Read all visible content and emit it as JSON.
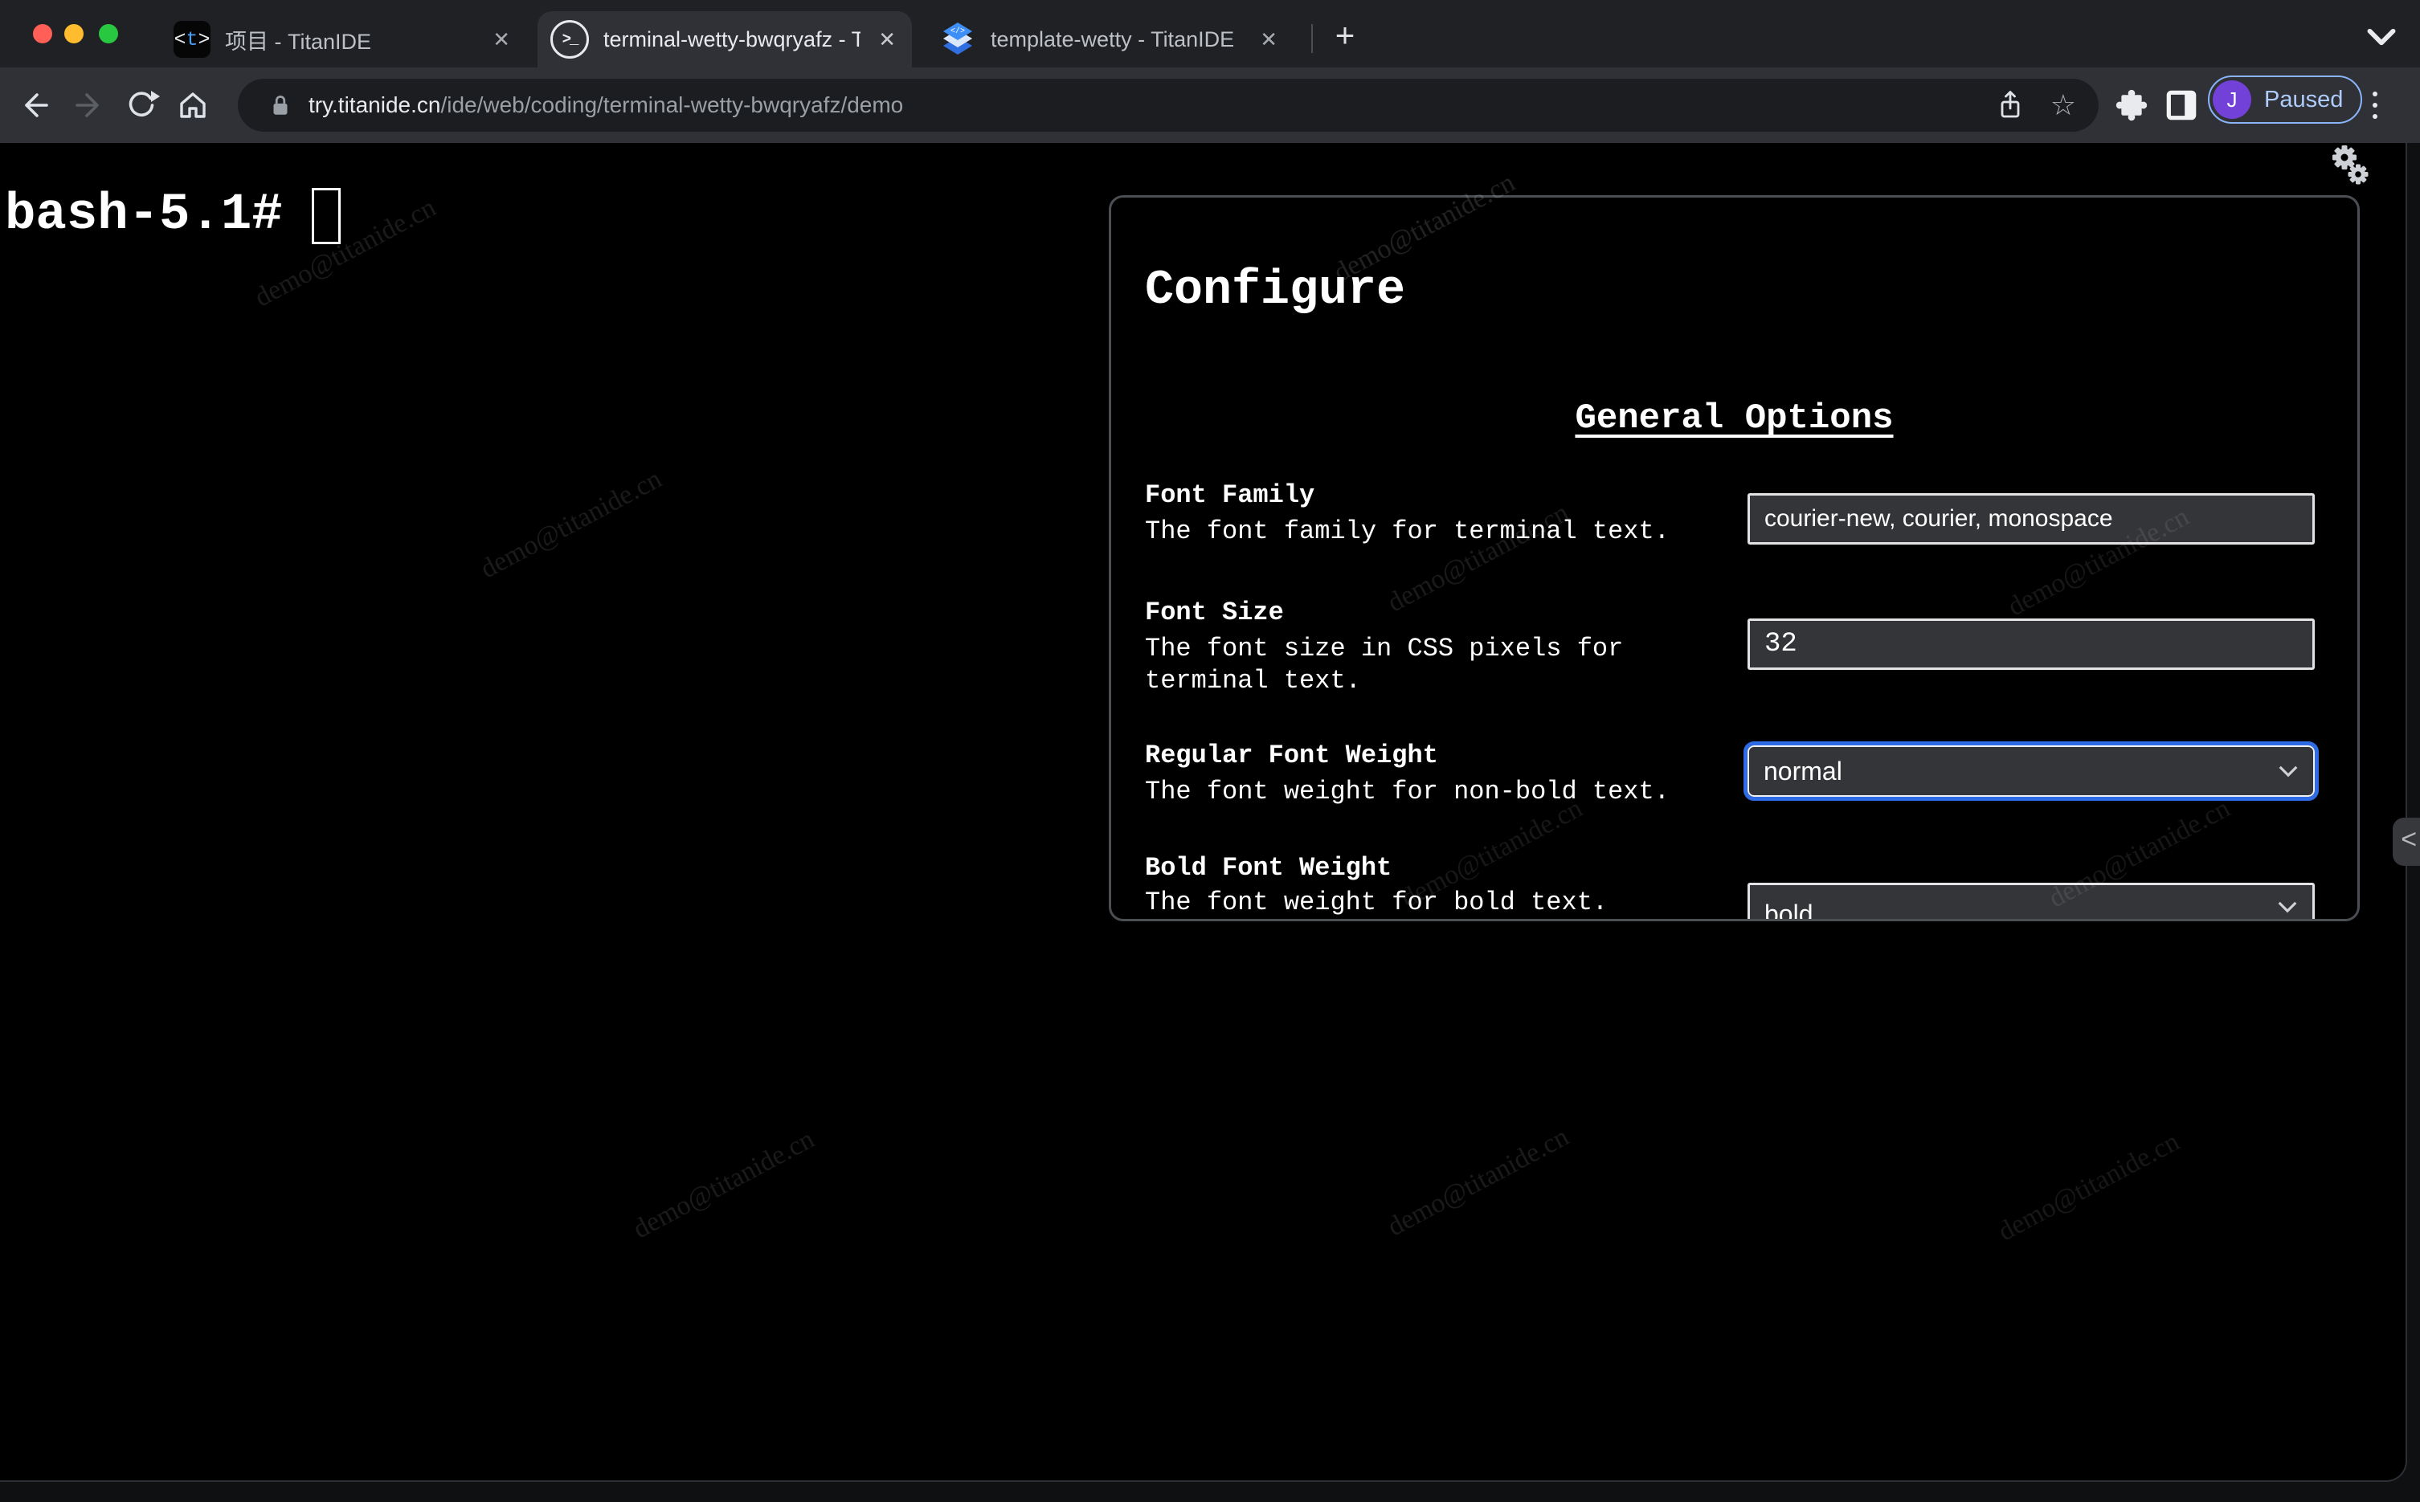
{
  "tabs": {
    "items": [
      {
        "title": "项目 - TitanIDE"
      },
      {
        "title": "terminal-wetty-bwqryafz - Tita"
      },
      {
        "title": "template-wetty - TitanIDE"
      }
    ],
    "close_glyph": "✕",
    "new_tab_glyph": "+",
    "favicon_titanide": {
      "open": "<",
      "t": "t",
      "close": ">"
    },
    "favicon_terminal": ">_",
    "favicon_layers_code": "</>"
  },
  "toolbar": {
    "url_domain": "try.titanide.cn",
    "url_path": "/ide/web/coding/terminal-wetty-bwqryafz/demo",
    "star_glyph": "☆",
    "profile": {
      "initial": "J",
      "status": "Paused"
    }
  },
  "terminal": {
    "prompt": "bash-5.1# "
  },
  "panel": {
    "title": "Configure",
    "section_title": "General Options",
    "fields": [
      {
        "label": "Font Family",
        "description": "The font family for terminal text.",
        "value": "courier-new, courier, monospace"
      },
      {
        "label": "Font Size",
        "description": "The font size in CSS pixels for terminal text.",
        "value": "32"
      },
      {
        "label": "Regular Font Weight",
        "description": "The font weight for non-bold text.",
        "value": "normal"
      },
      {
        "label": "Bold Font Weight",
        "description": "The font weight for bold text.",
        "value": "bold"
      }
    ],
    "collapse_glyph": "<"
  },
  "watermark": {
    "text": "demo@titanide.cn"
  },
  "colors": {
    "focus_ring": "#2f6be4",
    "paused_blue": "#aecbfa",
    "avatar_purple": "#7141d8",
    "accent_tab_blue": "#4a9ff5"
  }
}
